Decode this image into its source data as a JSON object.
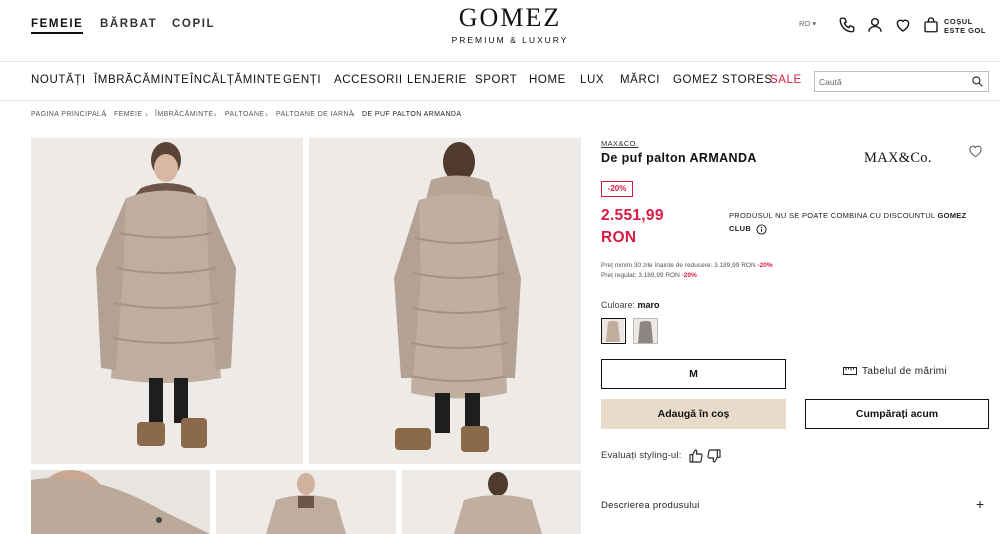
{
  "header": {
    "gender_tabs": [
      {
        "label": "FEMEIE",
        "active": true
      },
      {
        "label": "BĂRBAT",
        "active": false
      },
      {
        "label": "COPIL",
        "active": false
      }
    ],
    "logo_main": "GOMEZ",
    "logo_sub": "PREMIUM & LUXURY",
    "language": "RO ▾",
    "icons": [
      "phone-icon",
      "user-icon",
      "heart-icon",
      "bag-icon"
    ],
    "cart_line1": "COȘUL",
    "cart_line2": "ESTE GOL"
  },
  "nav": {
    "items": [
      "NOUTĂȚI",
      "ÎMBRĂCĂMINTE",
      "ÎNCĂLȚĂMINTE",
      "GENȚI",
      "ACCESORII",
      "LENJERIE",
      "SPORT",
      "HOME",
      "LUX",
      "MĂRCI",
      "GOMEZ STORES",
      "SALE"
    ],
    "search_placeholder": "Caută",
    "sale_color": "#d81b43"
  },
  "breadcrumb": [
    "PAGINA PRINCIPALĂ",
    "FEMEIE",
    "ÎMBRĂCĂMINTE",
    "PALTOANE",
    "PALTOANE DE IARNĂ",
    "DE PUF PALTON ARMANDA"
  ],
  "product": {
    "brand": "MAX&CO.",
    "brand_logo": "MAX&Co.",
    "title": "De puf palton ARMANDA",
    "discount": "-20%",
    "price": "2.551,99 RON",
    "no_combine_text": "PRODUSUL NU SE POATE COMBINA CU DISCOUNTUL ",
    "no_combine_bold": "GOMEZ CLUB",
    "min_price_label": "Preț minim 30 zile înainte de reducere: 3.189,99 RON ",
    "min_price_discount": "-20%",
    "regular_price_label": "Preț regulat: 3.189,99 RON ",
    "regular_price_discount": "-20%",
    "color_label": "Culoare: ",
    "color_value": "maro",
    "size": "M",
    "size_chart": "Tabelul de mărimi",
    "add_to_cart": "Adaugă în coș",
    "buy_now": "Cumpărați acum",
    "rate_styling": "Evaluați styling-ul:",
    "description": "Descrierea produsului",
    "accent_color": "#d81b43",
    "cart_button_color": "#e9dac9"
  }
}
